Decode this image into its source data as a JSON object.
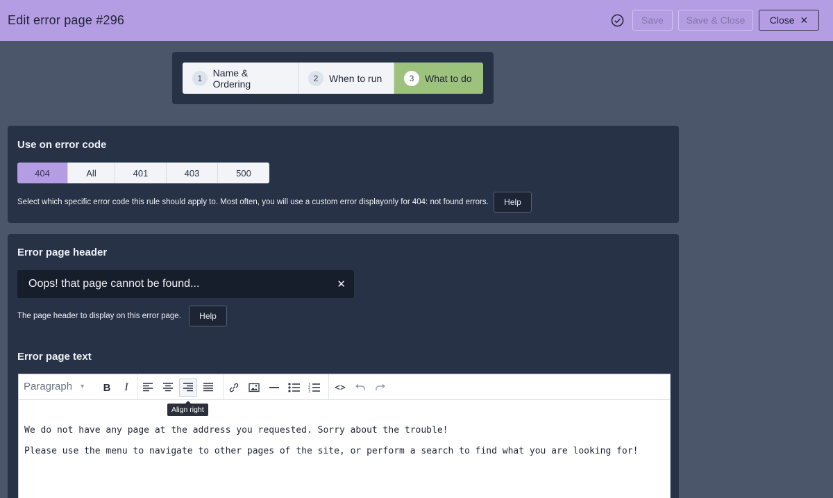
{
  "header": {
    "title": "Edit error page #296",
    "save_label": "Save",
    "save_close_label": "Save & Close",
    "close_label": "Close"
  },
  "wizard": {
    "steps": [
      {
        "num": "1",
        "label": "Name & Ordering"
      },
      {
        "num": "2",
        "label": "When to run"
      },
      {
        "num": "3",
        "label": "What to do"
      }
    ]
  },
  "error_code": {
    "heading": "Use on error code",
    "options": [
      "404",
      "All",
      "401",
      "403",
      "500"
    ],
    "selected": "404",
    "description": "Select which specific error code this rule should apply to. Most often, you will use a custom error displayonly for 404: not found errors.",
    "help_label": "Help"
  },
  "page_header": {
    "heading": "Error page header",
    "value": "Oops! that page cannot be found...",
    "description": "The page header to display on this error page.",
    "help_label": "Help"
  },
  "page_text": {
    "heading": "Error page text",
    "format_label": "Paragraph",
    "tooltip": "Align right",
    "paragraphs": [
      "We do not have any page at the address you requested. Sorry about the trouble!",
      "Please use the menu to navigate to other pages of the site, or perform a search to find what you are looking for!"
    ]
  },
  "colors": {
    "header_bg": "#b49de3",
    "accent_green": "#9dc27d",
    "panel_bg": "#273246",
    "page_bg": "#4b566b"
  }
}
